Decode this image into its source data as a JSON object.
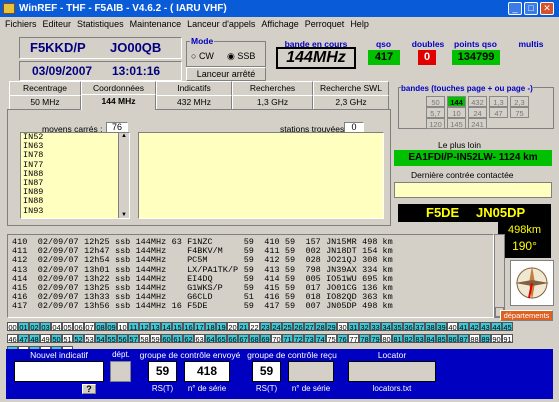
{
  "window": {
    "title": "WinREF - THF  -  F5AIB  -  V4.6.2  -  ( IARU VHF)"
  },
  "menu": [
    "Fichiers",
    "Editeur",
    "Statistiques",
    "Maintenance",
    "Lanceur d'appels",
    "Affichage",
    "Perroquet",
    "Help"
  ],
  "station": {
    "callsign": "F5KKD/P",
    "locator": "JO00QB",
    "date": "03/09/2007",
    "time": "13:01:16"
  },
  "mode": {
    "label": "Mode",
    "options": [
      "CW",
      "SSB"
    ],
    "selected": "SSB"
  },
  "launcher_status": "Lanceur arrêté",
  "band_current": {
    "label": "bande en cours",
    "value": "144MHz"
  },
  "qso": {
    "label": "qso",
    "value": "417"
  },
  "doubles": {
    "label": "doubles",
    "value": "0"
  },
  "points": {
    "label": "points qso",
    "value": "134799"
  },
  "multis": {
    "label": "multis"
  },
  "tabs_row1": [
    "Recentrage",
    "Coordonnées",
    "Indicatifs",
    "Recherches",
    "Recherche SWL"
  ],
  "tabs_row2": [
    "50 MHz",
    "144 MHz",
    "432 MHz",
    "1,3 GHz",
    "2,3 GHz"
  ],
  "active_band_tab": "144 MHz",
  "squares": {
    "label": "moyens carrés :",
    "count": "76",
    "items": [
      "IN52",
      "IN63",
      "IN78",
      "IN77",
      "IN88",
      "IN87",
      "IN89",
      "IN88",
      "IN93"
    ]
  },
  "stations": {
    "label": "stations trouvées :",
    "count": "0"
  },
  "bands_panel": {
    "label": "bandes (touches page + ou page -)",
    "row1": [
      "50",
      "144",
      "432",
      "1,3",
      "2,3"
    ],
    "row2": [
      "5,7",
      "10",
      "24",
      "47",
      "75"
    ],
    "row3": [
      "120",
      "145",
      "241"
    ],
    "active": "144"
  },
  "furthest": {
    "label": "Le plus loin",
    "value": "EA1FDI/P-IN52LW- 1124 km"
  },
  "last_contact": {
    "label": "Dernière contrée contactée",
    "value": ""
  },
  "current_station": {
    "callsign": "F5DE",
    "locator": "JN05DP",
    "distance": "498km",
    "bearing": "190°"
  },
  "departements_btn": "départements",
  "log": [
    [
      "410",
      "02/09/07",
      "12h25",
      "ssb",
      "144MHz",
      "63",
      "F1NZC",
      "59",
      "410",
      "59",
      "157",
      "JN15MR",
      "498 km"
    ],
    [
      "411",
      "02/09/07",
      "12h47",
      "ssb",
      "144MHz",
      "",
      "F4BKV/M",
      "59",
      "411",
      "59",
      "002",
      "JN18DT",
      "154 km"
    ],
    [
      "412",
      "02/09/07",
      "12h54",
      "ssb",
      "144MHz",
      "",
      "PC5M",
      "59",
      "412",
      "59",
      "028",
      "JO21QJ",
      "308 km"
    ],
    [
      "413",
      "02/09/07",
      "13h01",
      "ssb",
      "144MHz",
      "",
      "LX/PA1TK/P",
      "59",
      "413",
      "59",
      "798",
      "JN39AX",
      "334 km"
    ],
    [
      "414",
      "02/09/07",
      "13h22",
      "ssb",
      "144MHz",
      "",
      "EI4DQ",
      "59",
      "414",
      "59",
      "005",
      "IO51WU",
      "695 km"
    ],
    [
      "415",
      "02/09/07",
      "13h25",
      "ssb",
      "144MHz",
      "",
      "G1WKS/P",
      "59",
      "415",
      "59",
      "017",
      "JO01CG",
      "136 km"
    ],
    [
      "416",
      "02/09/07",
      "13h33",
      "ssb",
      "144MHz",
      "",
      "G6CLD",
      "51",
      "416",
      "59",
      "018",
      "IO82QD",
      "363 km"
    ],
    [
      "417",
      "02/09/07",
      "13h56",
      "ssb",
      "144MHz",
      "16",
      "F5DE",
      "59",
      "417",
      "59",
      "007",
      "JN05DP",
      "498 km"
    ]
  ],
  "dept_row1": [
    "00",
    "01",
    "02",
    "03",
    "04",
    "05",
    "06",
    "07",
    "08",
    "09",
    "10",
    "11",
    "12",
    "13",
    "14",
    "15",
    "16",
    "17",
    "18",
    "19",
    "20",
    "21",
    "22",
    "23",
    "24",
    "25",
    "26",
    "27",
    "28",
    "29",
    "30",
    "31",
    "32",
    "33",
    "34",
    "35",
    "36",
    "37",
    "38",
    "39",
    "40",
    "41",
    "42",
    "43",
    "44",
    "45"
  ],
  "dept_row2": [
    "46",
    "47",
    "48",
    "49",
    "50",
    "51",
    "52",
    "53",
    "54",
    "55",
    "56",
    "57",
    "58",
    "59",
    "60",
    "61",
    "62",
    "63",
    "64",
    "65",
    "66",
    "67",
    "68",
    "69",
    "70",
    "71",
    "72",
    "73",
    "74",
    "75",
    "76",
    "77",
    "78",
    "79",
    "80",
    "81",
    "82",
    "83",
    "84",
    "85",
    "86",
    "87",
    "88",
    "89",
    "90",
    "91"
  ],
  "dept_row3": [
    "92",
    "93",
    "94",
    "95",
    "2A",
    "2B"
  ],
  "dept_worked": [
    "01",
    "02",
    "03",
    "08",
    "09",
    "11",
    "12",
    "13",
    "14",
    "15",
    "16",
    "17",
    "18",
    "19",
    "21",
    "23",
    "24",
    "25",
    "26",
    "27",
    "28",
    "29",
    "31",
    "32",
    "33",
    "34",
    "35",
    "36",
    "37",
    "38",
    "39",
    "41",
    "42",
    "43",
    "44",
    "45",
    "47",
    "48",
    "50",
    "52",
    "54",
    "55",
    "56",
    "57",
    "60",
    "61",
    "62",
    "64",
    "65",
    "66",
    "67",
    "68",
    "69",
    "71",
    "72",
    "73",
    "74",
    "76",
    "78",
    "79",
    "81",
    "82",
    "83",
    "84",
    "85",
    "86",
    "87",
    "89",
    "92",
    "94",
    "2A"
  ],
  "bottom": {
    "new_call_label": "Nouvel indicatif",
    "dept_label": "dépt.",
    "help_btn": "?",
    "sent_label": "groupe de contrôle envoyé",
    "sent_rst": "59",
    "sent_serial": "418",
    "rst_label": "RS(T)",
    "serial_label": "n° de série",
    "recv_label": "groupe de contrôle reçu",
    "recv_rst": "59",
    "locator_label": "Locator",
    "locators_file": "locators.txt"
  }
}
